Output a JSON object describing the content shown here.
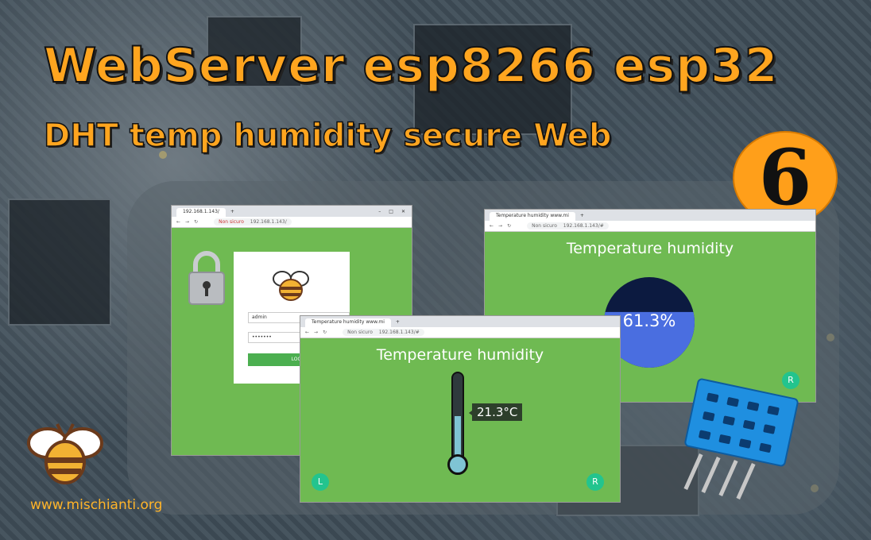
{
  "headline": "WebServer esp8266 esp32",
  "subheadline": "DHT temp humidity secure Web",
  "episode_number": "6",
  "footer_url": "www.mischianti.org",
  "login_window": {
    "tab_title": "192.168.1.143/",
    "new_tab": "+",
    "window_controls": [
      "–",
      "□",
      "✕"
    ],
    "security": "Non sicuro",
    "url": "192.168.1.143/",
    "username_value": "admin",
    "password_value": "•••••••",
    "login_button": "LOGIN"
  },
  "humidity_window": {
    "tab_title": "Temperature humidity www.mi",
    "new_tab": "+",
    "security": "Non sicuro",
    "url": "192.168.1.143/#",
    "page_title": "Temperature humidity",
    "humidity_value": "61.3%",
    "humidity_fraction": 0.613,
    "button_right": "R"
  },
  "temperature_window": {
    "tab_title": "Temperature humidity www.mi",
    "new_tab": "+",
    "security": "Non sicuro",
    "url": "192.168.1.143/#",
    "page_title": "Temperature humidity",
    "temperature_value": "21.3°C",
    "button_left": "L",
    "button_right": "R"
  },
  "colors": {
    "accent_orange": "#ffa51f",
    "page_green": "#6fba52",
    "round_button": "#23c48e",
    "humidity_blue": "#4a6ee0",
    "sensor_blue": "#1f8fe0"
  }
}
